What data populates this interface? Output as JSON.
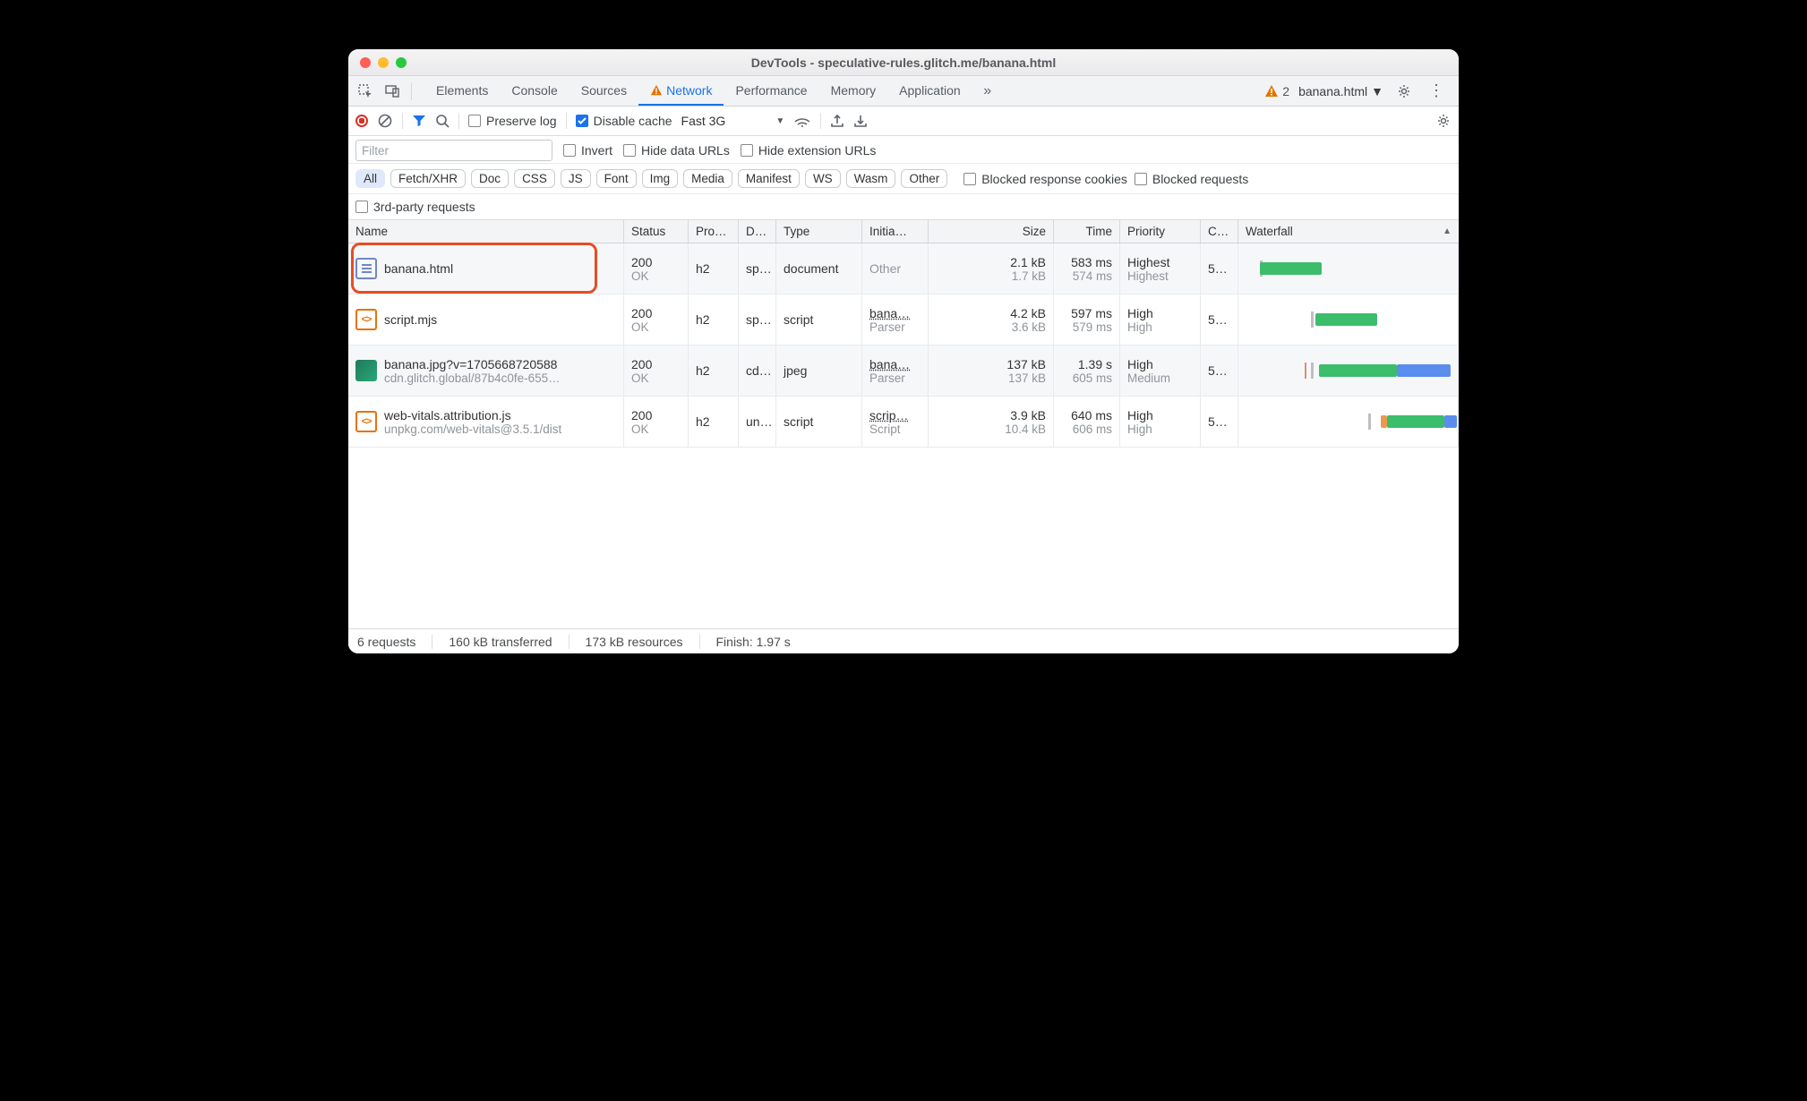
{
  "window": {
    "title": "DevTools - speculative-rules.glitch.me/banana.html"
  },
  "tabs": {
    "items": [
      "Elements",
      "Console",
      "Sources",
      "Network",
      "Performance",
      "Memory",
      "Application"
    ],
    "active": "Network",
    "network_warn": true,
    "warn_count": "2",
    "context": "banana.html"
  },
  "toolbar": {
    "preserve_log": "Preserve log",
    "disable_cache": "Disable cache",
    "throttling": "Fast 3G"
  },
  "filter": {
    "placeholder": "Filter",
    "invert": "Invert",
    "hide_data": "Hide data URLs",
    "hide_ext": "Hide extension URLs",
    "blocked_cookies": "Blocked response cookies",
    "blocked_req": "Blocked requests",
    "third_party": "3rd-party requests",
    "types": [
      "All",
      "Fetch/XHR",
      "Doc",
      "CSS",
      "JS",
      "Font",
      "Img",
      "Media",
      "Manifest",
      "WS",
      "Wasm",
      "Other"
    ],
    "type_selected": "All"
  },
  "columns": {
    "name": "Name",
    "status": "Status",
    "protocol": "Pro…",
    "domain": "D…",
    "type": "Type",
    "initiator": "Initia…",
    "size": "Size",
    "time": "Time",
    "priority": "Priority",
    "connection": "C…",
    "waterfall": "Waterfall"
  },
  "requests": [
    {
      "icon": "doc",
      "name": "banana.html",
      "subname": "",
      "status": "200",
      "status_txt": "OK",
      "protocol": "h2",
      "domain": "sp…",
      "type": "document",
      "initiator": "Other",
      "init_sub": "",
      "init_link": false,
      "size": "2.1 kB",
      "size_sub": "1.7 kB",
      "time": "583 ms",
      "time_sub": "574 ms",
      "priority": "Highest",
      "priority_sub": "Highest",
      "conn": "5…",
      "wf": {
        "start": 7,
        "wait": 0,
        "dl": 30,
        "tail": 0
      }
    },
    {
      "icon": "js",
      "name": "script.mjs",
      "subname": "",
      "status": "200",
      "status_txt": "OK",
      "protocol": "h2",
      "domain": "sp…",
      "type": "script",
      "initiator": "bana…",
      "init_sub": "Parser",
      "init_link": true,
      "size": "4.2 kB",
      "size_sub": "3.6 kB",
      "time": "597 ms",
      "time_sub": "579 ms",
      "priority": "High",
      "priority_sub": "High",
      "conn": "5…",
      "wf": {
        "start": 32,
        "wait": 2,
        "dl": 30,
        "tail": 0
      }
    },
    {
      "icon": "img",
      "name": "banana.jpg?v=1705668720588",
      "subname": "cdn.glitch.global/87b4c0fe-655…",
      "status": "200",
      "status_txt": "OK",
      "protocol": "h2",
      "domain": "cd…",
      "type": "jpeg",
      "initiator": "bana…",
      "init_sub": "Parser",
      "init_link": true,
      "size": "137 kB",
      "size_sub": "137 kB",
      "time": "1.39 s",
      "time_sub": "605 ms",
      "priority": "High",
      "priority_sub": "Medium",
      "conn": "5…",
      "wf": {
        "start": 32,
        "wait": 4,
        "dl": 38,
        "tail": 26,
        "nudge": true
      }
    },
    {
      "icon": "js",
      "name": "web-vitals.attribution.js",
      "subname": "unpkg.com/web-vitals@3.5.1/dist",
      "status": "200",
      "status_txt": "OK",
      "protocol": "h2",
      "domain": "un…",
      "type": "script",
      "initiator": "scrip…",
      "init_sub": "Script",
      "init_link": true,
      "size": "3.9 kB",
      "size_sub": "10.4 kB",
      "time": "640 ms",
      "time_sub": "606 ms",
      "priority": "High",
      "priority_sub": "High",
      "conn": "5…",
      "wf": {
        "start": 60,
        "wait": 6,
        "dl": 28,
        "tail": 6,
        "orange": true
      }
    }
  ],
  "statusbar": {
    "requests": "6 requests",
    "transferred": "160 kB transferred",
    "resources": "173 kB resources",
    "finish": "Finish: 1.97 s"
  }
}
